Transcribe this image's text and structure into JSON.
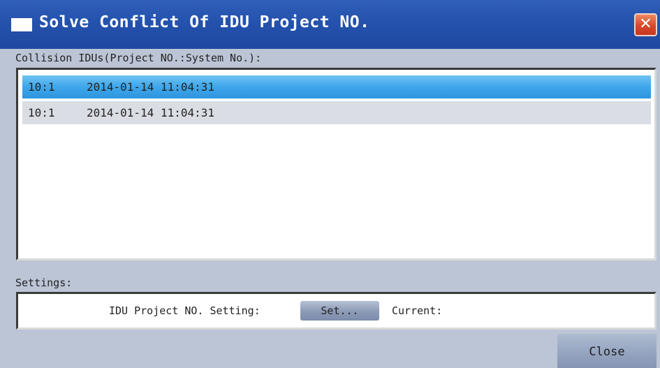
{
  "window": {
    "title": "Solve Conflict Of IDU Project NO.",
    "close_glyph": "✕",
    "colors": {
      "titlebar": "#2452ad",
      "body": "#bcc5d6",
      "selection": "#3ea6ea",
      "close_button": "#d7472a"
    }
  },
  "collision": {
    "label": "Collision IDUs(Project NO.:System No.):",
    "rows": [
      {
        "project": "10:1",
        "datetime": "2014-01-14 11:04:31",
        "selected": true
      },
      {
        "project": "10:1",
        "datetime": "2014-01-14 11:04:31",
        "selected": false
      }
    ]
  },
  "settings": {
    "label": "Settings:",
    "setting_label": "IDU Project NO. Setting:",
    "set_button": "Set...",
    "current_label": "Current:",
    "current_value": ""
  },
  "footer": {
    "close_button": "Close"
  },
  "icons": {
    "window_icon": "window-icon",
    "close_icon": "close-icon"
  }
}
